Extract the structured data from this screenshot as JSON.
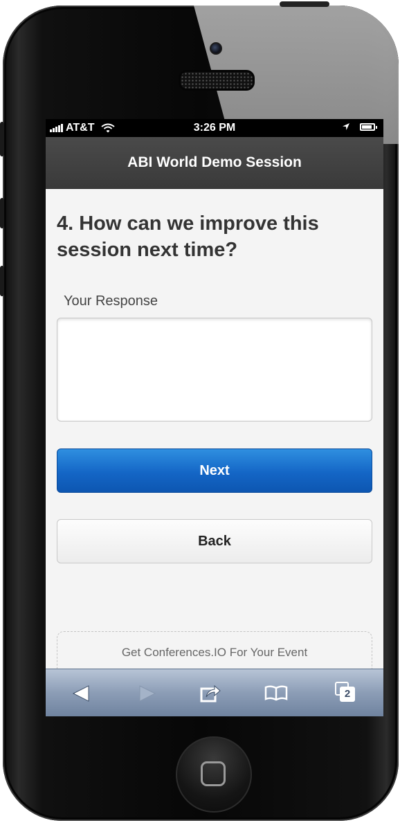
{
  "status_bar": {
    "carrier": "AT&T",
    "time": "3:26 PM"
  },
  "header": {
    "title": "ABI World Demo Session"
  },
  "question": {
    "text": "4. How can we improve this session next time?"
  },
  "response": {
    "label": "Your Response",
    "value": ""
  },
  "buttons": {
    "next_label": "Next",
    "back_label": "Back"
  },
  "footer": {
    "text": "Get Conferences.IO For Your Event"
  },
  "toolbar": {
    "tabs_count": "2",
    "icons": [
      "back-arrow-icon",
      "forward-arrow-icon",
      "share-icon",
      "bookmarks-icon",
      "tabs-icon"
    ]
  },
  "colors": {
    "primary_button": "#1466c6",
    "header_bg": "#404040"
  }
}
